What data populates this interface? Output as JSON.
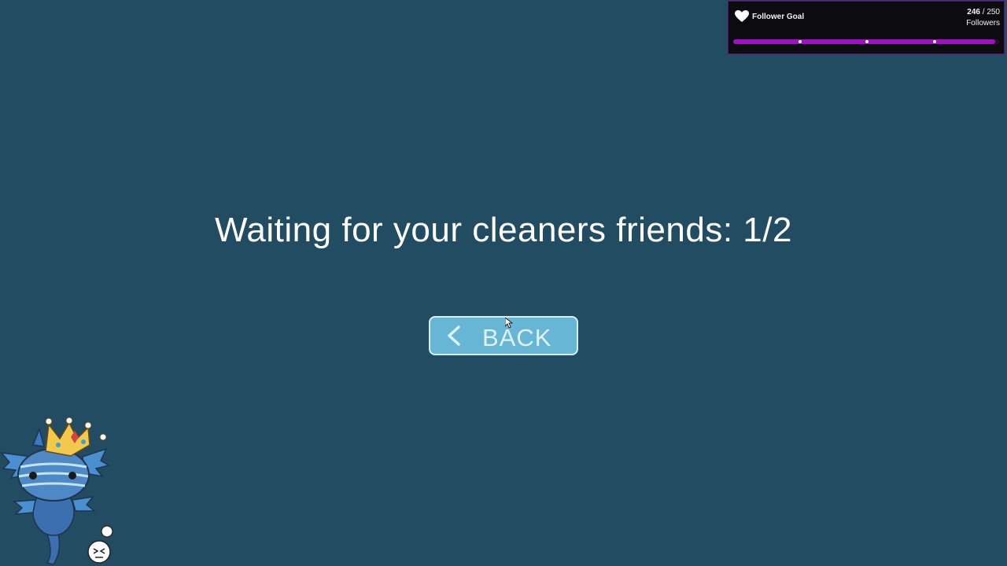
{
  "goal_widget": {
    "title": "Follower Goal",
    "current": "246",
    "separator": " / ",
    "target": "250",
    "unit": "Followers",
    "progress_fraction": 0.984,
    "accent_color": "#a010c8",
    "icon": "heart-icon"
  },
  "main": {
    "waiting_message": "Waiting for your cleaners friends: 1/2"
  },
  "back_button": {
    "label": "BACK",
    "icon": "chevron-left-icon"
  },
  "colors": {
    "background": "#214c62",
    "button": "#67b6d6"
  }
}
